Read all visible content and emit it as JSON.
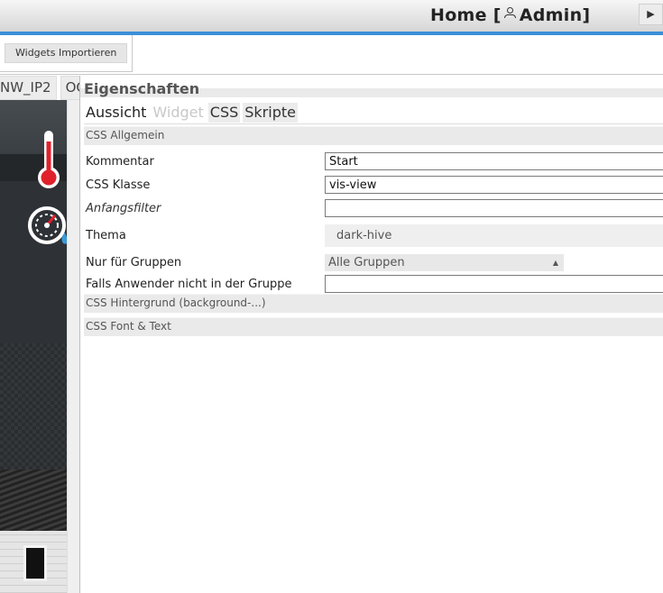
{
  "header": {
    "title_prefix": "Home [",
    "user": "Admin",
    "title_suffix": "]",
    "play_glyph": "▶"
  },
  "toolbar": {
    "import_label": "Widgets Importieren"
  },
  "view_tabs": [
    "NW_IP2",
    "OC"
  ],
  "properties": {
    "title": "Eigenschaften",
    "tabs": [
      {
        "label": "Aussicht",
        "state": "active"
      },
      {
        "label": "Widget",
        "state": "disabled"
      },
      {
        "label": "CSS",
        "state": "inactive"
      },
      {
        "label": "Skripte",
        "state": "inactive"
      }
    ],
    "sections": {
      "general": "CSS Allgemein",
      "background": "CSS Hintergrund (background-...)",
      "font": "CSS Font & Text"
    },
    "fields": {
      "comment": {
        "label": "Kommentar",
        "value": "Start"
      },
      "css_class": {
        "label": "CSS Klasse",
        "value": "vis-view"
      },
      "initial_filter": {
        "label": "Anfangsfilter",
        "value": ""
      },
      "theme": {
        "label": "Thema",
        "value": "dark-hive"
      },
      "groups": {
        "label": "Nur für Gruppen",
        "value": "Alle Gruppen"
      },
      "if_not_in_group": {
        "label": "Falls Anwender nicht in der Gruppe",
        "value": ""
      }
    }
  },
  "icons": {
    "user": "user-icon",
    "thermometer": "thermometer-icon",
    "gauge": "gauge-icon"
  },
  "colors": {
    "accent_line": "#3b8fd9",
    "thermo_red": "#e0212b"
  }
}
